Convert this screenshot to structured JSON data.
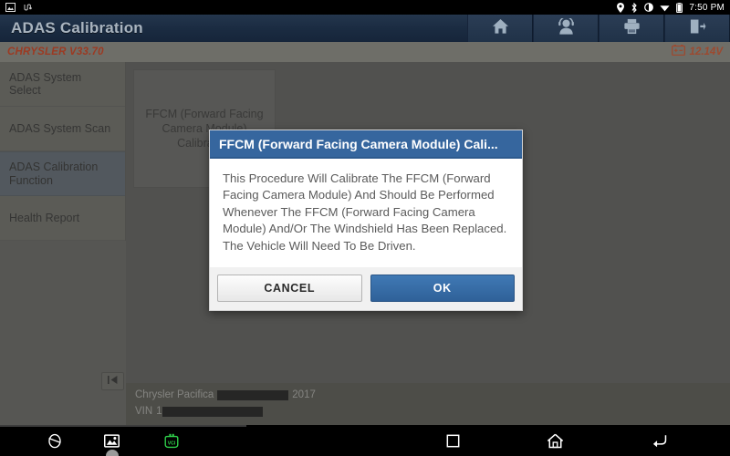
{
  "status_bar": {
    "left_icons": [
      "screenshot-icon",
      "usb-icon"
    ],
    "right_icons": [
      "location-icon",
      "bluetooth-icon",
      "rotation-icon",
      "wifi-icon",
      "battery-icon"
    ],
    "time": "7:50 PM"
  },
  "header": {
    "title": "ADAS Calibration",
    "actions": [
      {
        "name": "home-button",
        "icon": "home-icon"
      },
      {
        "name": "support-button",
        "icon": "headset-icon"
      },
      {
        "name": "print-button",
        "icon": "printer-icon"
      },
      {
        "name": "exit-button",
        "icon": "exit-icon"
      }
    ]
  },
  "subbar": {
    "brand_version": "CHRYSLER V33.70",
    "voltage": "12.14V",
    "voltage_icon": "car-battery-icon",
    "accent_color": "#9c3a22"
  },
  "sidebar": {
    "items": [
      {
        "label": "ADAS System Select",
        "active": false
      },
      {
        "label": "ADAS System Scan",
        "active": false
      },
      {
        "label": "ADAS Calibration Function",
        "active": true
      },
      {
        "label": "Health Report",
        "active": false
      }
    ],
    "collapse_icon": "collapse-left-icon"
  },
  "content": {
    "cards": [
      {
        "label": "FFCM (Forward Facing Camera Module) Calibration"
      }
    ]
  },
  "vehicle_footer": {
    "line1_prefix": "Chrysler Pacifica",
    "line1_redacted": true,
    "line1_suffix": "2017",
    "line2_label": "VIN",
    "line2_value": "1",
    "line2_redacted": true
  },
  "dialog": {
    "title": "FFCM (Forward Facing Camera Module) Cali...",
    "message": "This Procedure Will Calibrate The FFCM (Forward Facing Camera Module) And Should Be Performed Whenever The FFCM (Forward Facing Camera Module) And/Or The Windshield Has Been Replaced.  The Vehicle Will Need To Be Driven.",
    "cancel_label": "CANCEL",
    "ok_label": "OK",
    "title_bar_color": "#36669e",
    "ok_button_color": "#36669e"
  },
  "nav_bar": {
    "left": [
      {
        "name": "browser-icon"
      },
      {
        "name": "gallery-icon"
      },
      {
        "name": "vci-icon",
        "label": "VCI",
        "color": "#2fcf4a"
      }
    ],
    "right": [
      {
        "name": "recents-icon"
      },
      {
        "name": "home-icon"
      },
      {
        "name": "back-icon"
      }
    ]
  }
}
